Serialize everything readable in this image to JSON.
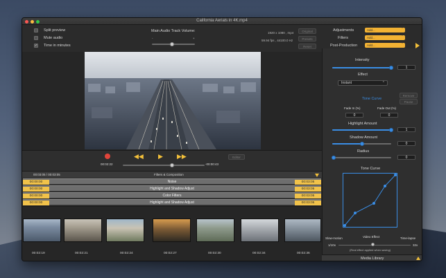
{
  "window": {
    "title": "California Aerials in 4K.mp4"
  },
  "options": {
    "split_preview": "Split preview",
    "mute_audio": "Mute audio",
    "time_in_minutes": "Time in minutes",
    "time_in_minutes_checked": true
  },
  "audio": {
    "label": "Main Audio Track Volume:",
    "minus": "-",
    "plus": "+",
    "volume": 0.55
  },
  "info": {
    "resolution": "1920 x 1080 , mp4",
    "rates": "59.94 fps , 44100.0 Hz"
  },
  "top_buttons": {
    "original": "Original",
    "presets": "Presets",
    "reset": "Reset"
  },
  "right_top": {
    "adjustments_label": "Adjustments",
    "adjustments_value": "Add...",
    "filters_label": "Filters",
    "filters_value": "Add...",
    "post_label": "Post-Production",
    "post_value": "Add..."
  },
  "playback": {
    "current_time": "00:02:22",
    "remaining": "-00:00:43",
    "editor": "Editor",
    "position": 0.6
  },
  "effects_header": {
    "time": "00:03:05 / 00:03:05",
    "title": "Filters & Composition"
  },
  "effects": [
    {
      "start": "00:00:00",
      "name": "Noise",
      "end": "00:03:05"
    },
    {
      "start": "00:00:00",
      "name": "Highlight and Shadow Adjust",
      "end": "00:03:05"
    },
    {
      "start": "00:00:00",
      "name": "Color Filters",
      "end": "00:03:05"
    },
    {
      "start": "00:00:00",
      "name": "Highlight and Shadow Adjust",
      "end": "00:03:05"
    }
  ],
  "timestamps": [
    "00:02:19",
    "00:02:21",
    "00:02:24",
    "00:02:27",
    "00:02:30",
    "00:02:34",
    "00:02:36"
  ],
  "panel": {
    "intensity_label": "Intensity",
    "intensity_value": "1",
    "effect_label": "Effect",
    "effect_value": "Instant",
    "tone_curve_link": "Tone Curve",
    "remove": "Remove",
    "pause": "Pause",
    "fade_in_label": "Fade In (%)",
    "fade_in_value": "0",
    "fade_out_label": "Fade Out (%)",
    "fade_out_value": "0",
    "highlight_label": "Highlight Amount",
    "highlight_value": "1",
    "shadow_label": "Shadow Amount",
    "shadow_value": "0",
    "radius_label": "Radius",
    "radius_value": "0",
    "tone_curve_label": "Tone Curve",
    "slow_motion": "Slow-motion",
    "video_effect": "Video Effect",
    "time_lapse": "Time-lapse",
    "speed_min": "1/10x",
    "speed_max": "32x",
    "realtime_note": "(Real effect applied when saving)",
    "media_library": "Media Library"
  },
  "colors": {
    "accent_blue": "#3a8ee6",
    "accent_orange": "#f2b233",
    "record_red": "#e0443a",
    "transport_yellow": "#f3c03a"
  }
}
